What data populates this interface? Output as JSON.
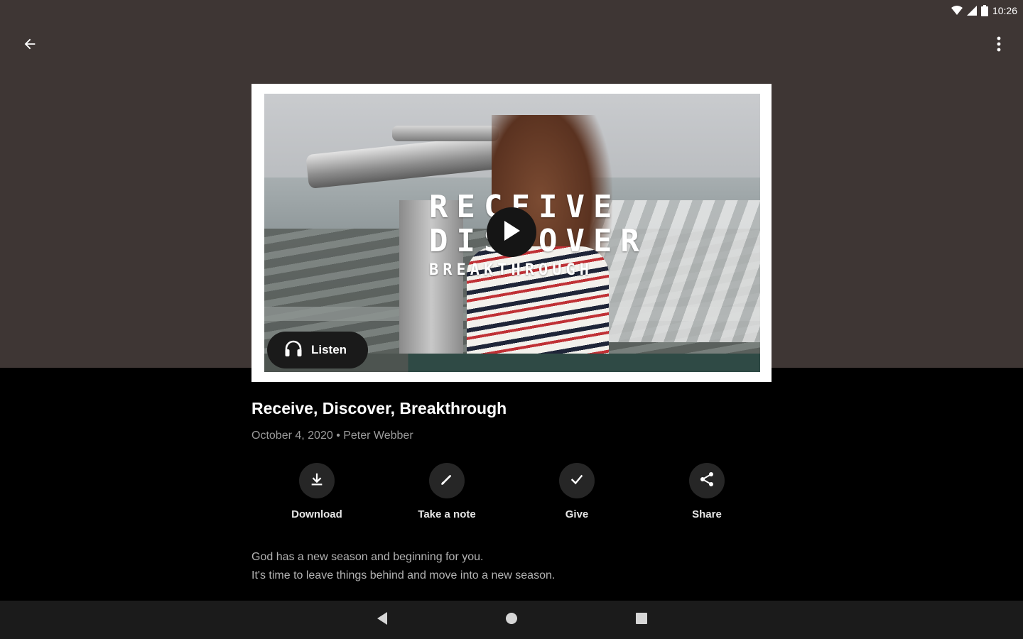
{
  "status_bar": {
    "time": "10:26"
  },
  "sermon": {
    "artwork": {
      "line1": "RECEIVE",
      "line2": "DISCOVER",
      "line3": "BREAKTHROUGH"
    },
    "listen_label": "Listen",
    "title": "Receive, Discover, Breakthrough",
    "meta": "October 4, 2020 • Peter Webber",
    "actions": [
      {
        "label": "Download",
        "icon": "download-icon"
      },
      {
        "label": "Take a note",
        "icon": "pencil-icon"
      },
      {
        "label": "Give",
        "icon": "check-icon"
      },
      {
        "label": "Share",
        "icon": "share-icon"
      }
    ],
    "description": {
      "line1": "God has a new season and beginning for you.",
      "line2": "It's time to leave things behind and move into a new season."
    }
  },
  "colors": {
    "header_background": "#3e3634",
    "page_background": "#000000",
    "action_circle": "#262626",
    "nav_bar": "#1b1b1b"
  }
}
